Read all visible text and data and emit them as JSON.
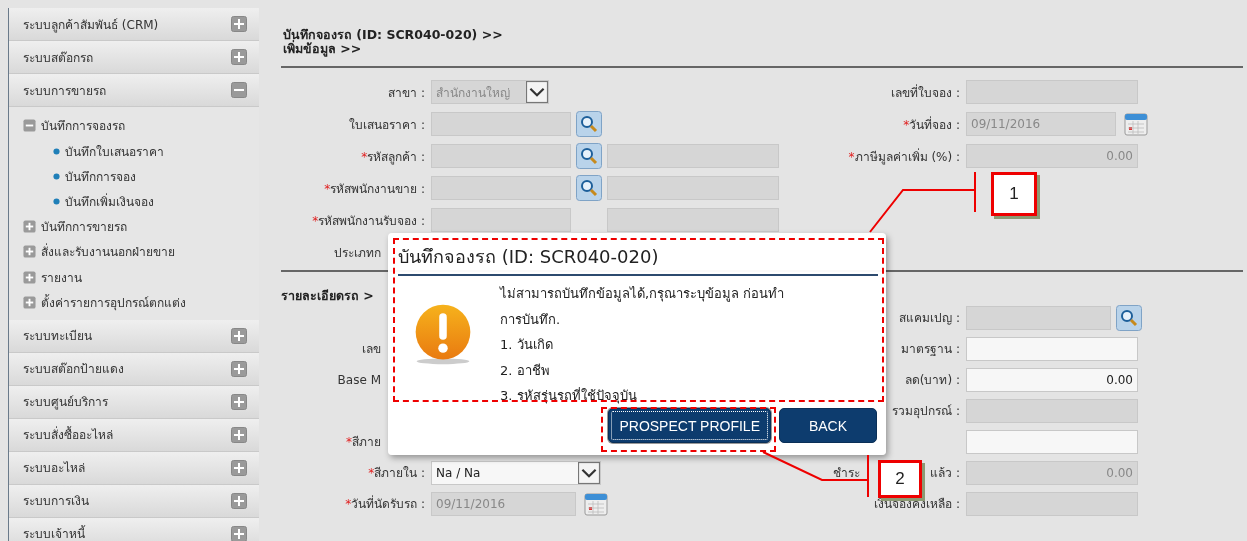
{
  "sidebar": [
    {
      "label": "ระบบลูกค้าสัมพันธ์ (CRM)",
      "expanded": false
    },
    {
      "label": "ระบบสต๊อกรถ",
      "expanded": false
    },
    {
      "label": "ระบบการขายรถ",
      "expanded": true,
      "children": [
        {
          "label": "บันทึกการจองรถ",
          "expanded": true,
          "children": [
            {
              "label": "บันทึกใบเสนอราคา"
            },
            {
              "label": "บันทึกการจอง"
            },
            {
              "label": "บันทึกเพิ่มเงินจอง"
            }
          ]
        },
        {
          "label": "บันทึกการขายรถ",
          "expanded": false
        },
        {
          "label": "สั่งและรับงานนอกฝ่ายขาย",
          "expanded": false
        },
        {
          "label": "รายงาน",
          "expanded": false
        },
        {
          "label": "ตั้งค่ารายการอุปกรณ์ตกแต่ง",
          "expanded": false
        }
      ]
    },
    {
      "label": "ระบบทะเบียน",
      "expanded": false
    },
    {
      "label": "ระบบสต๊อกป้ายแดง",
      "expanded": false
    },
    {
      "label": "ระบบศูนย์บริการ",
      "expanded": false
    },
    {
      "label": "ระบบสั่งซื้ออะไหล่",
      "expanded": false
    },
    {
      "label": "ระบบอะไหล่",
      "expanded": false
    },
    {
      "label": "ระบบการเงิน",
      "expanded": false
    },
    {
      "label": "ระบบเจ้าหนี้",
      "expanded": false
    }
  ],
  "breadcrumb": [
    "บันทึกจองรถ (ID: SCR040-020) >>",
    "เพิ่มข้อมูล >>"
  ],
  "booking_form": {
    "left": [
      {
        "label": "สาขา :",
        "kind": "select",
        "value": "สำนักงานใหญ่",
        "disabled": true
      },
      {
        "label": "ใบเสนอราคา :",
        "kind": "lookup",
        "disabled": true,
        "extra_field": false
      },
      {
        "required_mark": "*",
        "label": "รหัสลูกค้า :",
        "kind": "lookup",
        "disabled": true,
        "extra_field": true
      },
      {
        "required_mark": "*",
        "label": "รหัสพนักงานขาย :",
        "kind": "lookup",
        "disabled": true,
        "extra_field": true
      },
      {
        "required_mark": "*",
        "label": "รหัสพนักงานรับจอง :",
        "kind": "text",
        "disabled": true,
        "extra_field": true
      },
      {
        "label": "ประเภทก",
        "kind": "blank",
        "label_cut": true
      }
    ],
    "right": [
      {
        "label": "เลขที่ใบจอง :",
        "kind": "text",
        "disabled": true
      },
      {
        "required_mark": "*",
        "label": "วันที่จอง :",
        "kind": "date",
        "value": "09/11/2016",
        "disabled": true
      },
      {
        "required_mark": "*",
        "label": "ภาษีมูลค่าเพิ่ม (%) :",
        "kind": "number",
        "value": "0.00",
        "disabled": true
      }
    ]
  },
  "car_section": {
    "title": "รายละเอียดรถ >",
    "left": [
      {
        "kind": "blank"
      },
      {
        "label": "เลข",
        "kind": "blank",
        "label_cut": true
      },
      {
        "label": "Base M",
        "kind": "blank",
        "label_cut": true
      },
      {
        "kind": "blank"
      },
      {
        "required_mark": "*",
        "label": "สีภาย",
        "kind": "blank",
        "label_cut": true
      },
      {
        "required_mark": "*",
        "label": "สีภายใน :",
        "kind": "select",
        "value": "Na / Na",
        "disabled": false
      },
      {
        "required_mark": "*",
        "label": "วันที่นัดรับรถ :",
        "kind": "date",
        "value": "09/11/2016",
        "disabled": true
      }
    ],
    "right": [
      {
        "label": "สแคมเปญ :",
        "kind": "lookup",
        "disabled": true
      },
      {
        "label": "มาตรฐาน :",
        "kind": "text",
        "disabled": false
      },
      {
        "label": "ลด(บาท) :",
        "kind": "number",
        "value": "0.00",
        "disabled": false
      },
      {
        "label": "รวมอุปกรณ์ :",
        "kind": "text",
        "disabled": true
      },
      {
        "kind": "text",
        "disabled": false
      },
      {
        "covered_prefix": "ชำระ",
        "label": "แล้ว :",
        "kind": "number",
        "value": "0.00",
        "disabled": true
      },
      {
        "label": "เงินจองคงเหลือ :",
        "kind": "text",
        "disabled": true
      }
    ]
  },
  "dialog": {
    "title": "บันทึกจองรถ (ID: SCR040-020)",
    "message_lines": [
      "ไม่สามารถบันทึกข้อมูลได้,กรุณาระบุข้อมูล ก่อนทำ",
      "การบันทึก.",
      "1. วันเกิด",
      "2. อาชีพ",
      "3. รหัสรุ่นรถที่ใช้ปัจจุบัน"
    ],
    "buttons": [
      {
        "label": "PROSPECT PROFILE",
        "focused": true
      },
      {
        "label": "BACK",
        "focused": false
      }
    ]
  },
  "annotations": [
    {
      "label": "1"
    },
    {
      "label": "2"
    }
  ]
}
